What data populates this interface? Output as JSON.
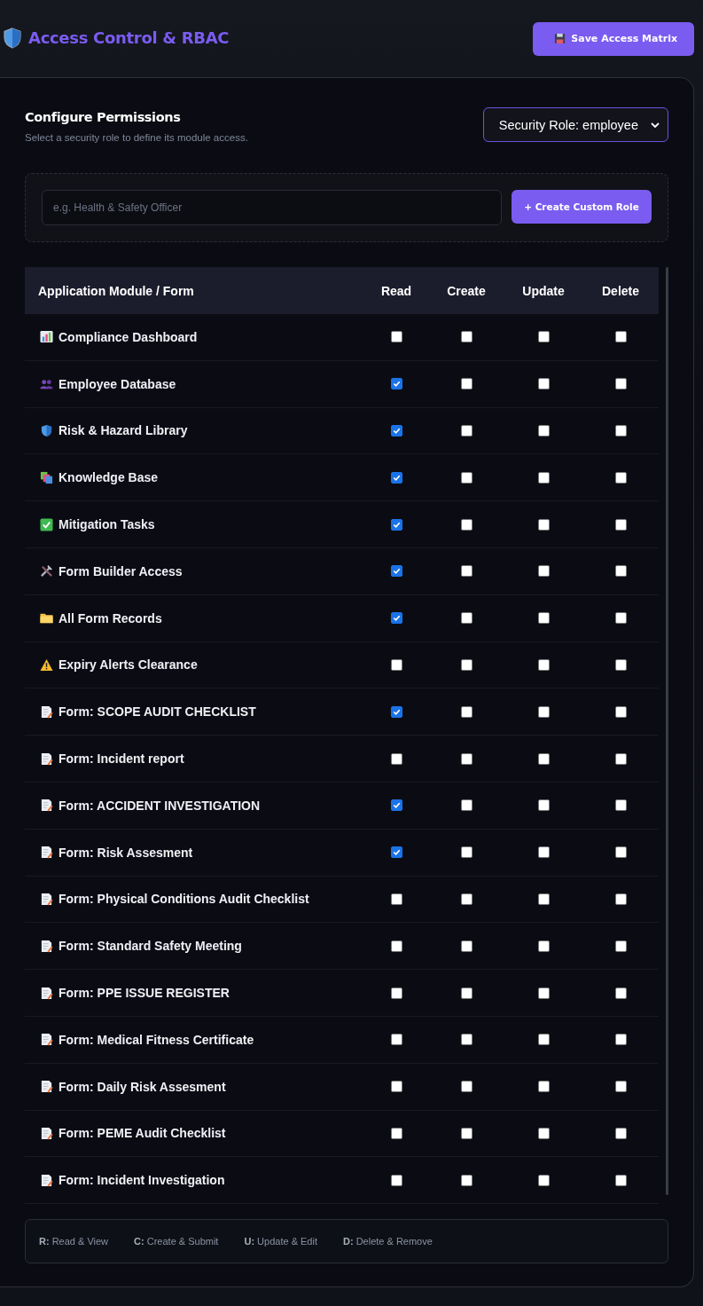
{
  "header": {
    "title": "Access Control & RBAC",
    "save_button": "Save Access Matrix"
  },
  "config": {
    "title": "Configure Permissions",
    "subtitle": "Select a security role to define its module access.",
    "role_select": "Security Role: employee"
  },
  "custom_role": {
    "placeholder": "e.g. Health & Safety Officer",
    "button": "+ Create Custom Role"
  },
  "table": {
    "columns": [
      "Application Module / Form",
      "Read",
      "Create",
      "Update",
      "Delete"
    ],
    "rows": [
      {
        "kind": "dashboard",
        "label": "Compliance Dashboard",
        "read": false,
        "create": false,
        "update": false,
        "delete": false
      },
      {
        "kind": "people",
        "label": "Employee Database",
        "read": true,
        "create": false,
        "update": false,
        "delete": false
      },
      {
        "kind": "shield",
        "label": "Risk & Hazard Library",
        "read": true,
        "create": false,
        "update": false,
        "delete": false
      },
      {
        "kind": "books",
        "label": "Knowledge Base",
        "read": true,
        "create": false,
        "update": false,
        "delete": false
      },
      {
        "kind": "tasks",
        "label": "Mitigation Tasks",
        "read": true,
        "create": false,
        "update": false,
        "delete": false
      },
      {
        "kind": "tools",
        "label": "Form Builder Access",
        "read": true,
        "create": false,
        "update": false,
        "delete": false
      },
      {
        "kind": "folder",
        "label": "All Form Records",
        "read": true,
        "create": false,
        "update": false,
        "delete": false
      },
      {
        "kind": "warning",
        "label": "Expiry Alerts Clearance",
        "read": false,
        "create": false,
        "update": false,
        "delete": false
      },
      {
        "kind": "form",
        "label": "Form: SCOPE AUDIT CHECKLIST",
        "read": true,
        "create": false,
        "update": false,
        "delete": false
      },
      {
        "kind": "form",
        "label": "Form: Incident report",
        "read": false,
        "create": false,
        "update": false,
        "delete": false
      },
      {
        "kind": "form",
        "label": "Form: ACCIDENT INVESTIGATION",
        "read": true,
        "create": false,
        "update": false,
        "delete": false
      },
      {
        "kind": "form",
        "label": "Form: Risk Assesment",
        "read": true,
        "create": false,
        "update": false,
        "delete": false
      },
      {
        "kind": "form",
        "label": "Form: Physical Conditions Audit Checklist",
        "read": false,
        "create": false,
        "update": false,
        "delete": false
      },
      {
        "kind": "form",
        "label": "Form: Standard Safety Meeting",
        "read": false,
        "create": false,
        "update": false,
        "delete": false
      },
      {
        "kind": "form",
        "label": "Form: PPE ISSUE REGISTER",
        "read": false,
        "create": false,
        "update": false,
        "delete": false
      },
      {
        "kind": "form",
        "label": "Form: Medical Fitness Certificate",
        "read": false,
        "create": false,
        "update": false,
        "delete": false
      },
      {
        "kind": "form",
        "label": "Form: Daily Risk Assesment",
        "read": false,
        "create": false,
        "update": false,
        "delete": false
      },
      {
        "kind": "form",
        "label": "Form: PEME Audit Checklist",
        "read": false,
        "create": false,
        "update": false,
        "delete": false
      },
      {
        "kind": "form",
        "label": "Form: Incident Investigation",
        "read": false,
        "create": false,
        "update": false,
        "delete": false
      }
    ]
  },
  "legend": [
    "**R:** Read & View",
    "**C:** Create & Submit",
    "**U:** Update & Edit",
    "**D:** Delete & Remove"
  ]
}
